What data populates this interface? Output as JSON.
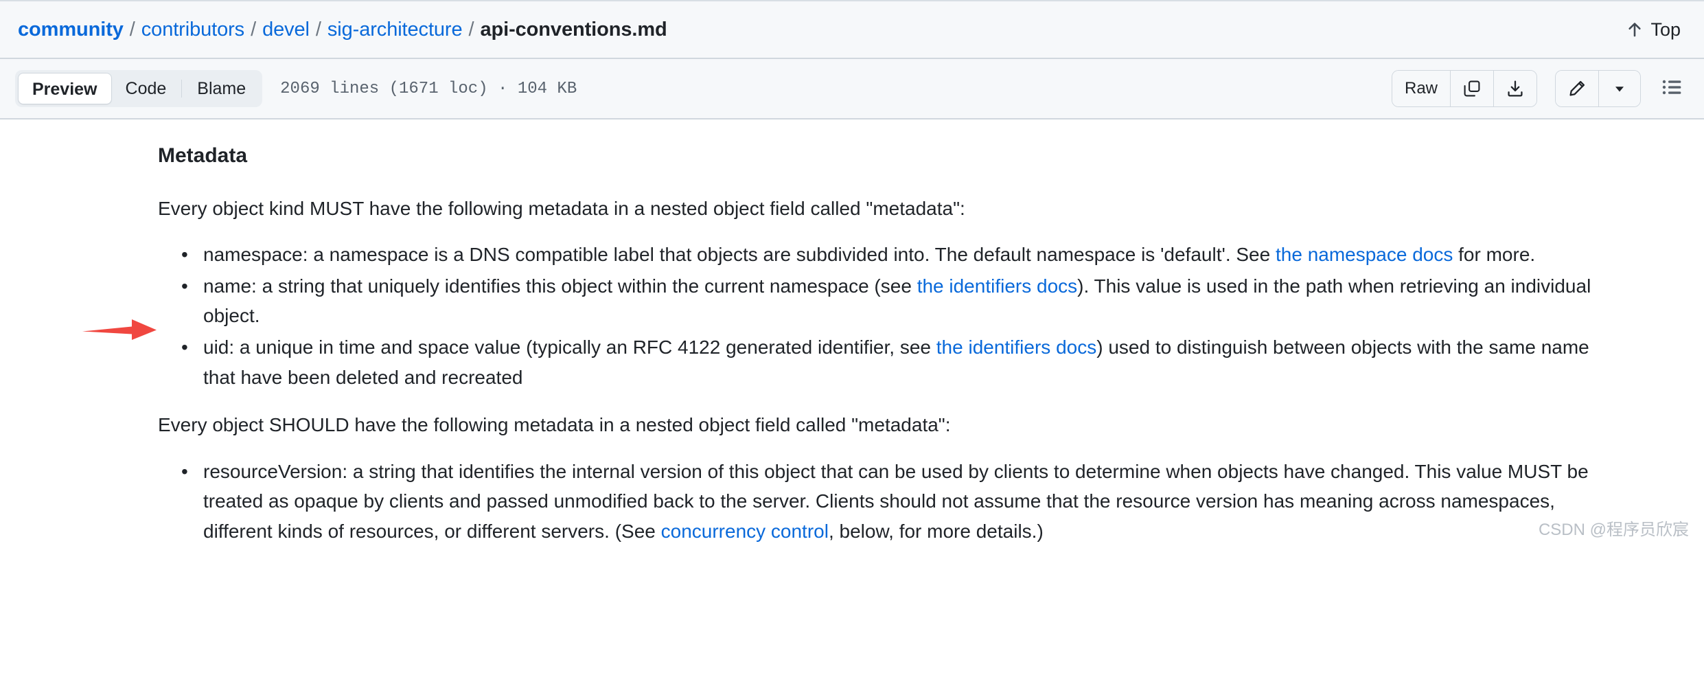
{
  "header": {
    "breadcrumb": [
      {
        "label": "community",
        "type": "link-root"
      },
      {
        "label": "contributors",
        "type": "link"
      },
      {
        "label": "devel",
        "type": "link"
      },
      {
        "label": "sig-architecture",
        "type": "link"
      },
      {
        "label": "api-conventions.md",
        "type": "current"
      }
    ],
    "separator": "/",
    "top_button": {
      "label": "Top",
      "icon": "arrow-up-icon"
    }
  },
  "toolbar": {
    "tabs": [
      {
        "label": "Preview",
        "active": true
      },
      {
        "label": "Code",
        "active": false
      },
      {
        "label": "Blame",
        "active": false
      }
    ],
    "file_stats": "2069 lines (1671 loc) · 104 KB",
    "raw_label": "Raw",
    "copy_icon": "copy-icon",
    "download_icon": "download-icon",
    "edit_icon": "pencil-icon",
    "edit_dropdown_icon": "chevron-down-icon",
    "outline_icon": "list-unordered-icon"
  },
  "content": {
    "heading": "Metadata",
    "intro_must": "Every object kind MUST have the following metadata in a nested object field called \"metadata\":",
    "must_items": [
      {
        "part1": "namespace: a namespace is a DNS compatible label that objects are subdivided into. The default namespace is 'default'. See ",
        "link": "the namespace docs",
        "part2": " for more."
      },
      {
        "part1": "name: a string that uniquely identifies this object within the current namespace (see ",
        "link": "the identifiers docs",
        "part2": "). This value is used in the path when retrieving an individual object."
      },
      {
        "part1": "uid: a unique in time and space value (typically an RFC 4122 generated identifier, see ",
        "link": "the identifiers docs",
        "part2": ") used to distinguish between objects with the same name that have been deleted and recreated"
      }
    ],
    "intro_should": "Every object SHOULD have the following metadata in a nested object field called \"metadata\":",
    "should_items": [
      {
        "part1": "resourceVersion: a string that identifies the internal version of this object that can be used by clients to determine when objects have changed. This value MUST be treated as opaque by clients and passed unmodified back to the server. Clients should not assume that the resource version has meaning across namespaces, different kinds of resources, or different servers. (See ",
        "link": "concurrency control",
        "part2": ", below, for more details.)"
      }
    ],
    "annotation": {
      "type": "red-arrow",
      "color": "#f04740"
    },
    "watermark": "CSDN @程序员欣宸"
  }
}
